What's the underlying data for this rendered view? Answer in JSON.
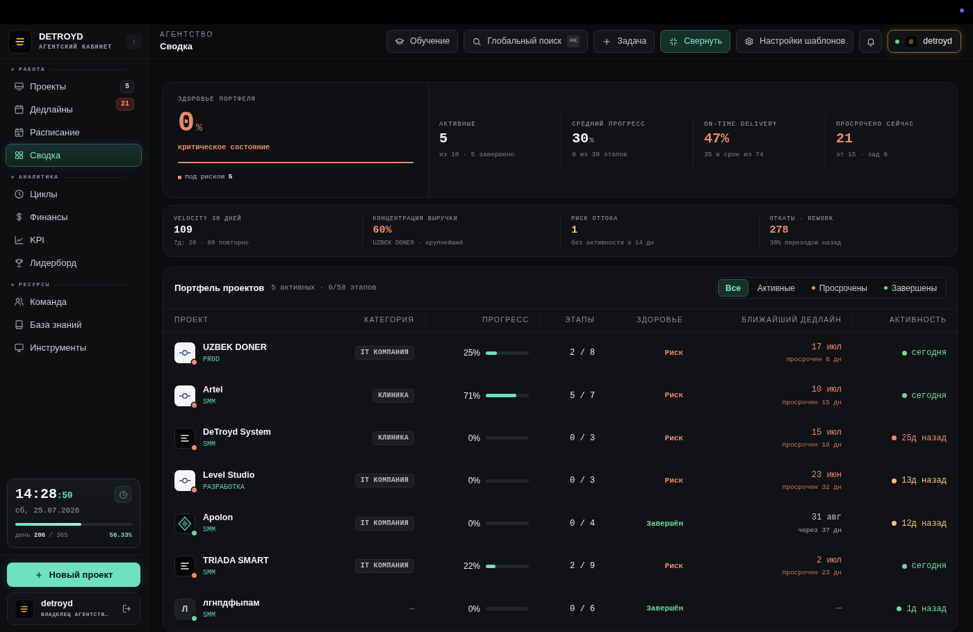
{
  "sidebar": {
    "brand": {
      "name": "DETROYD",
      "subtitle": "АГЕНТСКИЙ КАБИНЕТ"
    },
    "sections": [
      {
        "title": "РАБОТА",
        "items": [
          {
            "label": "Проекты",
            "selected": false,
            "badge": {
              "text": "5",
              "alert": false
            }
          },
          {
            "label": "Дедлайны",
            "selected": false,
            "badge": {
              "text": "21",
              "alert": true
            }
          },
          {
            "label": "Расписание",
            "selected": false
          },
          {
            "label": "Сводка",
            "selected": true
          }
        ]
      },
      {
        "title": "АНАЛИТИКА",
        "items": [
          {
            "label": "Циклы",
            "selected": false
          },
          {
            "label": "Финансы",
            "selected": false
          },
          {
            "label": "KPI",
            "selected": false
          },
          {
            "label": "Лидерборд",
            "selected": false
          }
        ]
      },
      {
        "title": "РЕСУРСЫ",
        "items": [
          {
            "label": "Команда",
            "selected": false
          },
          {
            "label": "База знаний",
            "selected": false
          },
          {
            "label": "Инструменты",
            "selected": false
          }
        ]
      }
    ],
    "clock": {
      "time": "14:28",
      "seconds": ":50",
      "date": "сб, 25.07.2026",
      "level": 0.5633,
      "day": "день **206** / 365",
      "percent": "56.33%"
    },
    "new_project_button": "Новый проект",
    "user": {
      "name": "detroyd",
      "role": "ВЛАДЕЛЕЦ АГЕНТСТВ…"
    }
  },
  "header": {
    "breadcrumb": "АГЕНТСТВО",
    "title": "Сводка",
    "buttons": [
      {
        "label": "Обучение",
        "active": false
      },
      {
        "label": "Глобальный поиск",
        "shortcut": "⌘K",
        "active": false
      },
      {
        "label": "Задача",
        "active": false
      },
      {
        "label": "Свернуть",
        "active": true
      },
      {
        "label": "Настройки шаблонов",
        "active": false
      }
    ],
    "user_chip": {
      "name": "detroyd",
      "online": true
    }
  },
  "health": {
    "title": "ЗДОРОВЬЕ ПОРТФЕЛЯ",
    "value": "0",
    "unit": "%",
    "status": "критическое состояние",
    "at_risk": "под риском **5**"
  },
  "stats": [
    {
      "label": "АКТИВНЫЕ",
      "value": "5",
      "sub": "из 10 · 5 завершено",
      "color": "#f2f3f5"
    },
    {
      "label": "СРЕДНИЙ ПРОГРЕСС",
      "value": "30",
      "unit": "%",
      "sub": "9 из 30 этапов",
      "color": "#f2f3f5"
    },
    {
      "label": "ON-TIME DELIVERY",
      "value": "47%",
      "sub": "35 в срок из 74",
      "color": "#ef8a6a"
    },
    {
      "label": "ПРОСРОЧЕНО СЕЙЧАС",
      "value": "21",
      "sub": "эт 15 · зад 6",
      "color": "#ef8a6a"
    }
  ],
  "metrics": [
    {
      "label": "VELOCITY 30 ДНЕЙ",
      "value": "109",
      "sub": "7д: 20 · 80 повторно",
      "color": "#f2f3f5"
    },
    {
      "label": "КОНЦЕНТРАЦИЯ ВЫРУЧКИ",
      "value": "60%",
      "sub": "UZBEK DONER · крупнейший",
      "color": "#ef8a6a"
    },
    {
      "label": "РИСК ОТТОКА",
      "value": "1",
      "sub": "без активности ≥ 14 дн",
      "color": "#f0c674"
    },
    {
      "label": "ОТКАТЫ · REWORK",
      "value": "278",
      "sub": "30% переходов назад",
      "color": "#ef8a6a"
    }
  ],
  "portfolio": {
    "title": "Портфель проектов",
    "meta": "5 активных · 9/58 этапов",
    "filters": [
      {
        "label": "Все",
        "selected": true
      },
      {
        "label": "Активные",
        "selected": false
      },
      {
        "label": "Просрочены",
        "selected": false,
        "color": "#ef8a6a"
      },
      {
        "label": "Завершены",
        "selected": false,
        "color": "#6fd89a"
      }
    ],
    "table": {
      "columns": [
        "ПРОЕКТ",
        "КАТЕГОРИЯ",
        "ПРОГРЕСС",
        "ЭТАПЫ",
        "ЗДОРОВЬЕ",
        "БЛИЖАЙШИЙ ДЕДЛАЙН",
        "АКТИВНОСТЬ"
      ],
      "rows": [
        {
          "name": "UZBEK DONER",
          "tag": "PROD",
          "logo": {
            "kind": "light"
          },
          "status": {
            "color": "#ef8a6a"
          },
          "category": {
            "kind": "chip",
            "text": "IT КОМПАНИЯ"
          },
          "progress": {
            "text": "25%",
            "level": 0.25
          },
          "stages": "2 / 8",
          "health": {
            "text": "Риск",
            "color": "#ef8a6a"
          },
          "deadline": {
            "date": "17 июл",
            "note": "просрочен 8 дн",
            "color": "#ef8a6a"
          },
          "activity": {
            "text": "сегодня",
            "color": "#6fd89a"
          }
        },
        {
          "name": "Artel",
          "tag": "SMM",
          "logo": {
            "kind": "light"
          },
          "status": {
            "color": "#ef8a6a"
          },
          "category": {
            "kind": "chip",
            "text": "КЛИНИКА"
          },
          "progress": {
            "text": "71%",
            "level": 0.71
          },
          "stages": "5 / 7",
          "health": {
            "text": "Риск",
            "color": "#ef8a6a"
          },
          "deadline": {
            "date": "10 июл",
            "note": "просрочен 15 дн",
            "color": "#ef8a6a"
          },
          "activity": {
            "text": "сегодня",
            "color": "#6fd89a"
          }
        },
        {
          "name": "DeTroyd System",
          "tag": "SMM",
          "logo": {
            "kind": "dark"
          },
          "status": {
            "color": "#ef8a6a"
          },
          "category": {
            "kind": "chip",
            "text": "КЛИНИКА"
          },
          "progress": {
            "text": "0%",
            "level": 0
          },
          "stages": "0 / 3",
          "health": {
            "text": "Риск",
            "color": "#ef8a6a"
          },
          "deadline": {
            "date": "15 июл",
            "note": "просрочен 10 дн",
            "color": "#ef8a6a"
          },
          "activity": {
            "text": "25д назад",
            "color": "#ef8a6a"
          }
        },
        {
          "name": "Level Studio",
          "tag": "РАЗРАБОТКА",
          "logo": {
            "kind": "light"
          },
          "status": {
            "color": "#ef8a6a"
          },
          "category": {
            "kind": "chip",
            "text": "IT КОМПАНИЯ"
          },
          "progress": {
            "text": "0%",
            "level": 0
          },
          "stages": "0 / 3",
          "health": {
            "text": "Риск",
            "color": "#ef8a6a"
          },
          "deadline": {
            "date": "23 июн",
            "note": "просрочен 32 дн",
            "color": "#ef8a6a"
          },
          "activity": {
            "text": "13д назад",
            "color": "#f0c674"
          }
        },
        {
          "name": "Apolon",
          "tag": "SMM",
          "logo": {
            "kind": "pattern"
          },
          "status": {
            "color": "#6fd89a"
          },
          "category": {
            "kind": "chip",
            "text": "IT КОМПАНИЯ"
          },
          "progress": {
            "text": "0%",
            "level": 0
          },
          "stages": "0 / 4",
          "health": {
            "text": "Завершён",
            "color": "#6fd89a"
          },
          "deadline": {
            "date": "31 авг",
            "note": "через 37 дн",
            "color": "#c4c7cc"
          },
          "activity": {
            "text": "12д назад",
            "color": "#f0c674"
          }
        },
        {
          "name": "TRIADA SMART",
          "tag": "SMM",
          "logo": {
            "kind": "dark"
          },
          "status": {
            "color": "#ef8a6a"
          },
          "category": {
            "kind": "chip",
            "text": "IT КОМПАНИЯ"
          },
          "progress": {
            "text": "22%",
            "level": 0.22
          },
          "stages": "2 / 9",
          "health": {
            "text": "Риск",
            "color": "#ef8a6a"
          },
          "deadline": {
            "date": "2 июл",
            "note": "просрочен 23 дн",
            "color": "#ef8a6a"
          },
          "activity": {
            "text": "сегодня",
            "color": "#6fd89a"
          }
        },
        {
          "name": "лгнпдфыпам",
          "tag": "SMM",
          "logo": {
            "kind": "letter",
            "letter": "Л"
          },
          "status": {
            "color": "#6fd89a"
          },
          "category": {
            "kind": "plain",
            "text": "—"
          },
          "progress": {
            "text": "0%",
            "level": 0
          },
          "stages": "0 / 6",
          "health": {
            "text": "Завершён",
            "color": "#6fd89a"
          },
          "deadline": {
            "date": "—"
          },
          "activity": {
            "text": "1д назад",
            "color": "#6fd89a"
          }
        }
      ]
    }
  }
}
